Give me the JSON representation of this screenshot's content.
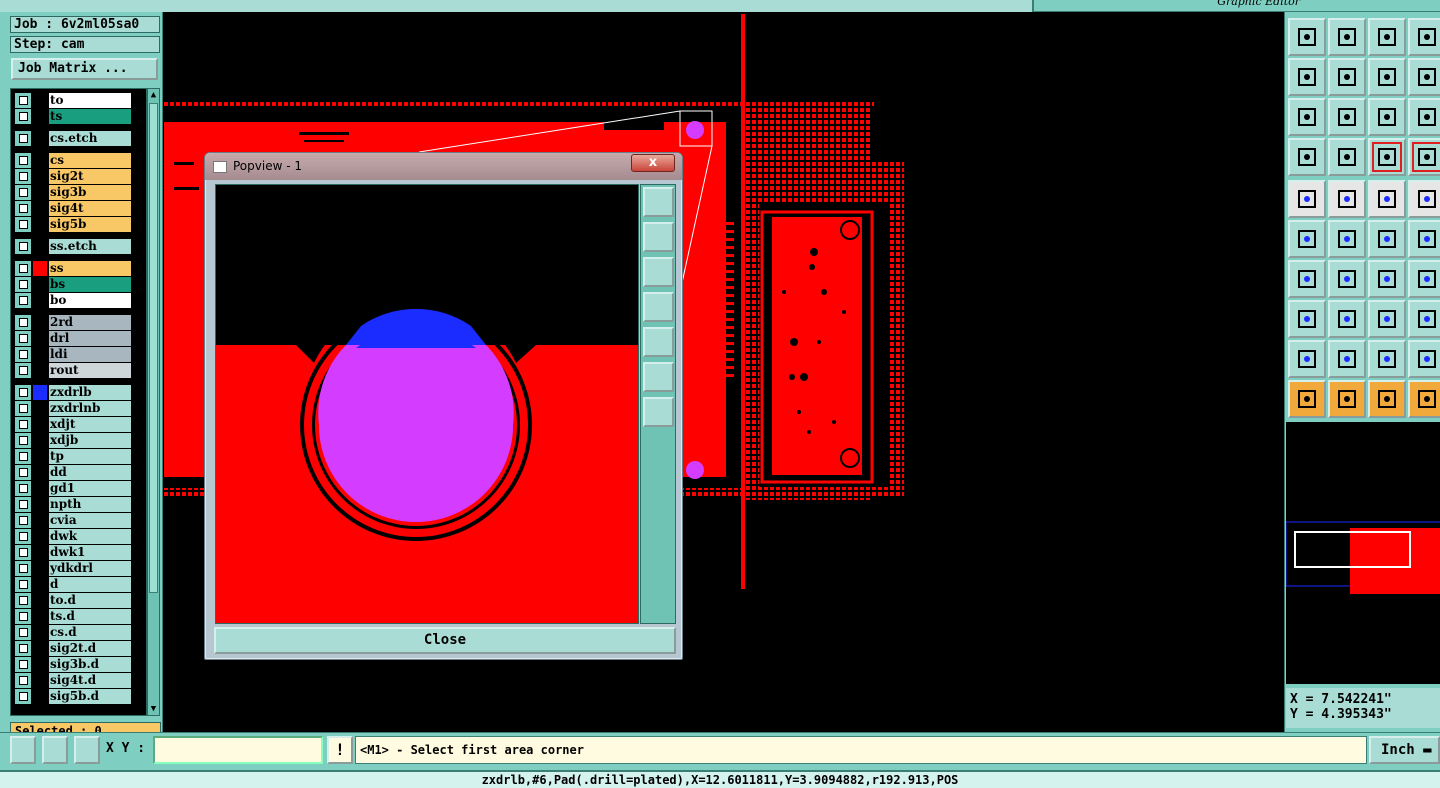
{
  "window": {
    "title": "Graphic Editor"
  },
  "job": {
    "job_line": "Job : 6v2ml05sa0",
    "step_line": "Step: cam",
    "matrix_button": "Job Matrix ..."
  },
  "layers": [
    {
      "name": "to",
      "bg": "#ffffff",
      "swatch": "#000000"
    },
    {
      "name": "ts",
      "bg": "#1a9e80",
      "swatch": "#000000"
    },
    {
      "name": "cs.etch",
      "bg": "#a9dcd4",
      "swatch": "#000000"
    },
    {
      "name": "cs",
      "bg": "#f9c866",
      "swatch": "#000000"
    },
    {
      "name": "sig2t",
      "bg": "#f9c866",
      "swatch": "#000000"
    },
    {
      "name": "sig3b",
      "bg": "#f9c866",
      "swatch": "#000000"
    },
    {
      "name": "sig4t",
      "bg": "#f9c866",
      "swatch": "#000000"
    },
    {
      "name": "sig5b",
      "bg": "#f9c866",
      "swatch": "#000000"
    },
    {
      "name": "ss.etch",
      "bg": "#a9dcd4",
      "swatch": "#000000"
    },
    {
      "name": "ss",
      "bg": "#f9c866",
      "swatch": "#ff0000"
    },
    {
      "name": "bs",
      "bg": "#1a9e80",
      "swatch": "#000000"
    },
    {
      "name": "bo",
      "bg": "#ffffff",
      "swatch": "#000000"
    },
    {
      "name": "2rd",
      "bg": "#a8b6bf",
      "swatch": "#000000"
    },
    {
      "name": "drl",
      "bg": "#a8b6bf",
      "swatch": "#000000"
    },
    {
      "name": "ldi",
      "bg": "#a8b6bf",
      "swatch": "#000000"
    },
    {
      "name": "rout",
      "bg": "#cfd6da",
      "swatch": "#000000"
    },
    {
      "name": "zxdrlb",
      "bg": "#a9dcd4",
      "swatch": "#1a2cff",
      "active": true
    },
    {
      "name": "zxdrlnb",
      "bg": "#a9dcd4",
      "swatch": "#000000"
    },
    {
      "name": "xdjt",
      "bg": "#a9dcd4",
      "swatch": "#000000"
    },
    {
      "name": "xdjb",
      "bg": "#a9dcd4",
      "swatch": "#000000"
    },
    {
      "name": "tp",
      "bg": "#a9dcd4",
      "swatch": "#000000"
    },
    {
      "name": "dd",
      "bg": "#a9dcd4",
      "swatch": "#000000"
    },
    {
      "name": "gd1",
      "bg": "#a9dcd4",
      "swatch": "#000000"
    },
    {
      "name": "npth",
      "bg": "#a9dcd4",
      "swatch": "#000000"
    },
    {
      "name": "cvia",
      "bg": "#a9dcd4",
      "swatch": "#000000"
    },
    {
      "name": "dwk",
      "bg": "#a9dcd4",
      "swatch": "#000000"
    },
    {
      "name": "dwk1",
      "bg": "#a9dcd4",
      "swatch": "#000000"
    },
    {
      "name": "ydkdrl",
      "bg": "#a9dcd4",
      "swatch": "#000000"
    },
    {
      "name": "d",
      "bg": "#a9dcd4",
      "swatch": "#000000"
    },
    {
      "name": "to.d",
      "bg": "#a9dcd4",
      "swatch": "#000000"
    },
    {
      "name": "ts.d",
      "bg": "#a9dcd4",
      "swatch": "#000000"
    },
    {
      "name": "cs.d",
      "bg": "#a9dcd4",
      "swatch": "#000000"
    },
    {
      "name": "sig2t.d",
      "bg": "#a9dcd4",
      "swatch": "#000000"
    },
    {
      "name": "sig3b.d",
      "bg": "#a9dcd4",
      "swatch": "#000000"
    },
    {
      "name": "sig4t.d",
      "bg": "#a9dcd4",
      "swatch": "#000000"
    },
    {
      "name": "sig5b.d",
      "bg": "#a9dcd4",
      "swatch": "#000000"
    }
  ],
  "selected_text": "Selected : 0",
  "popview": {
    "title": "Popview - 1",
    "close_x": "x",
    "close_button": "Close",
    "side_icons": [
      "zoom-window-icon",
      "pan-up-icon",
      "pan-down-icon",
      "pan-left-icon",
      "pan-right-icon",
      "zoom-in-icon",
      "zoom-out-icon"
    ]
  },
  "toolbar_icons": [
    [
      "layer-up-icon",
      "layer-down-icon",
      "home-icon",
      "split-view-icon"
    ],
    [
      "pan-left-icon",
      "pan-right-icon",
      "redo-view-icon",
      "snap-icon"
    ],
    [
      "fit-icon",
      "center-icon",
      "scale-1-2-icon",
      "help-icon"
    ],
    [
      "measure-tool-icon",
      "grid-icon",
      "netlist-icon",
      "netlist2-icon"
    ],
    [
      "pad-icon",
      "draw-line-icon",
      "ruler-icon",
      "dot-icon"
    ],
    [
      "connect-icon",
      "delete-feature-icon",
      "add-arc-icon",
      "add-pad-icon"
    ],
    [
      "angle-line-icon",
      "slash-line-icon",
      "arc-icon",
      "text-icon"
    ],
    [
      "move-pad-icon",
      "line-icon",
      "dimension-icon",
      "resize-icon"
    ],
    [
      "triangle-icon",
      "polygon-icon",
      "surface-icon",
      "surface2-icon"
    ],
    [
      "select-icon",
      "select-box-icon",
      "select-circle-icon",
      "select-net-icon"
    ]
  ],
  "coords": {
    "x": "X = 7.542241\"",
    "y": "Y = 4.395343\""
  },
  "bottom": {
    "xy_label": "X Y :",
    "xy_value": "",
    "excl": "!",
    "prompt": "<M1> - Select first area corner",
    "units": "Inch"
  },
  "status": "zxdrlb,#6,Pad(.drill=plated),X=12.6011811,Y=3.9094882,r192.913,POS",
  "colors": {
    "board_red": "#ff0000",
    "drill_magenta": "#d43cff",
    "panel_teal": "#7ecfc1",
    "blue_layer": "#1a2cff"
  }
}
